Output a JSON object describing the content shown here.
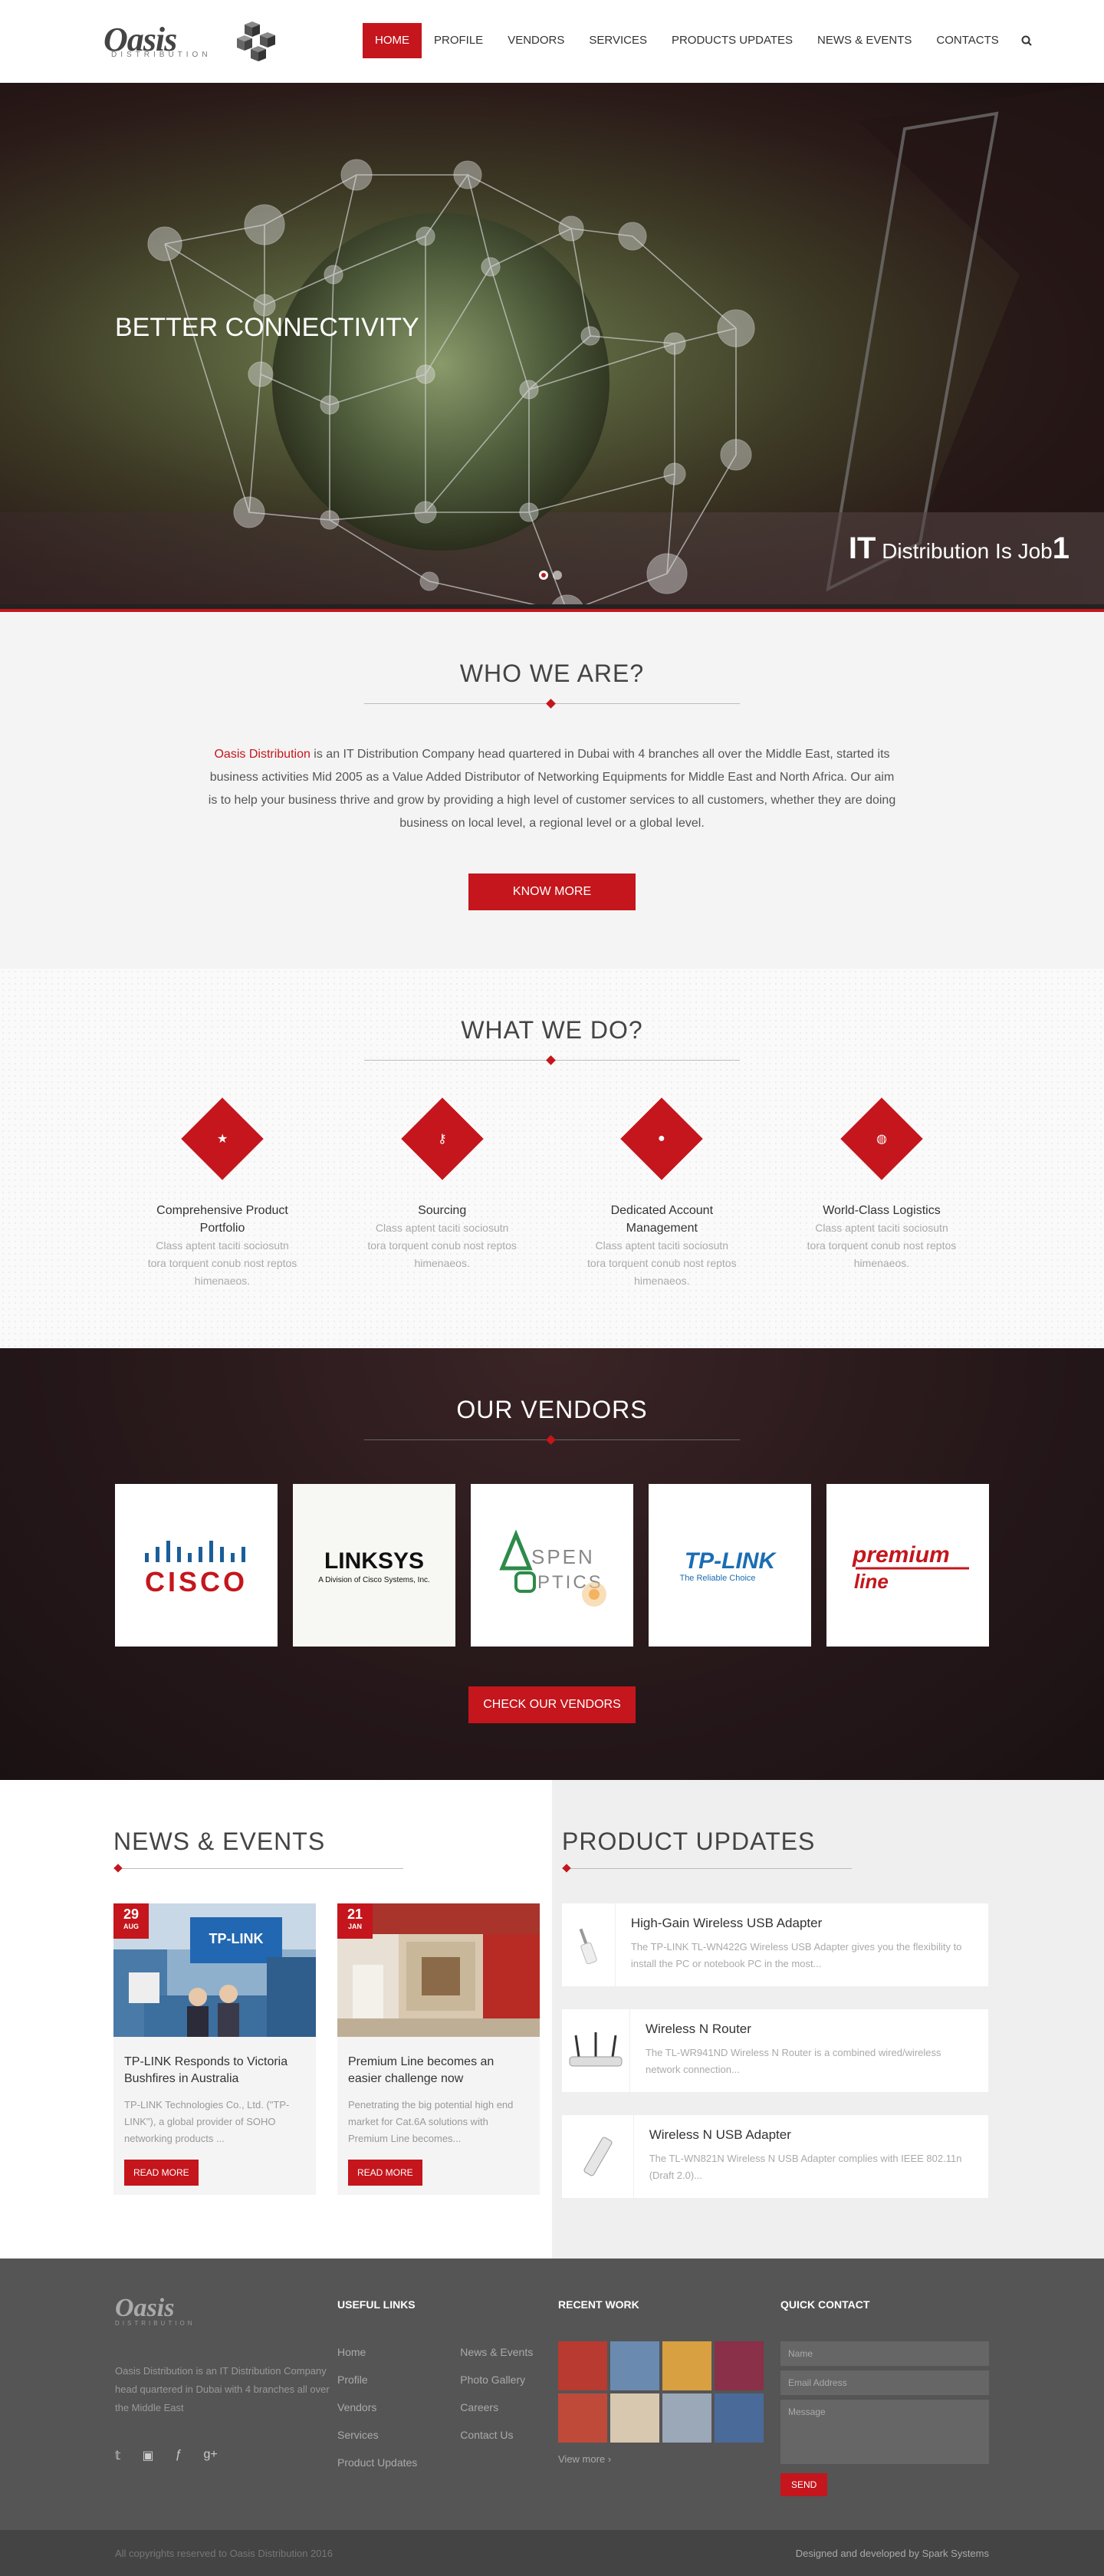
{
  "brand": {
    "logo_word": "Oasis",
    "logo_sub": "DISTRIBUTION"
  },
  "nav": {
    "items": [
      {
        "label": "HOME",
        "active": true
      },
      {
        "label": "PROFILE"
      },
      {
        "label": "VENDORS"
      },
      {
        "label": "SERVICES"
      },
      {
        "label": "PRODUCTS UPDATES"
      },
      {
        "label": "NEWS & EVENTS"
      },
      {
        "label": "CONTACTS"
      }
    ],
    "search_icon": "search-icon"
  },
  "hero": {
    "title": "BETTER CONNECTIVITY",
    "tagline_big": "IT",
    "tagline_mid": "Distribution Is Job",
    "tagline_num": "1"
  },
  "who": {
    "title": "WHO WE ARE?",
    "highlight": "Oasis Distribution",
    "body": " is an IT Distribution Company head quartered in Dubai with 4 branches all over the Middle East, started its business activities Mid 2005 as a Value Added Distributor of Networking Equipments for Middle East and North Africa. Our aim is to help your business thrive and grow by providing a high level of customer services to all customers, whether they are doing business on local level, a regional level or a global level.",
    "button": "KNOW MORE"
  },
  "what": {
    "title": "WHAT WE DO?",
    "services": [
      {
        "icon": "star-icon",
        "title": "Comprehensive Product Portfolio",
        "text": "Class aptent taciti sociosutn tora torquent conub nost reptos himenaeos."
      },
      {
        "icon": "key-icon",
        "title": "Sourcing",
        "text": "Class aptent taciti sociosutn tora torquent conub nost reptos himenaeos."
      },
      {
        "icon": "user-icon",
        "title": "Dedicated Account Management",
        "text": "Class aptent taciti sociosutn tora torquent conub nost reptos himenaeos."
      },
      {
        "icon": "globe-icon",
        "title": "World-Class Logistics",
        "text": "Class aptent taciti sociosutn tora torquent conub nost reptos himenaeos."
      }
    ]
  },
  "vendors": {
    "title": "OUR VENDORS",
    "logos": {
      "cisco": "CISCO",
      "linksys": "LINKSYS",
      "linksys_sub": "A Division of Cisco Systems, Inc.",
      "aspen_1": "SPEN",
      "aspen_2": "PTICS",
      "tplink": "TP-LINK",
      "tplink_sub": "The Reliable Choice",
      "premium_1": "premium",
      "premium_2": "line"
    },
    "button": "CHECK OUR VENDORS"
  },
  "news": {
    "title": "NEWS & EVENTS",
    "items": [
      {
        "day": "29",
        "month": "AUG",
        "title": "TP-LINK Responds to Victoria Bushfires in Australia",
        "excerpt": "TP-LINK Technologies Co., Ltd. (\"TP-LINK\"), a global provider of SOHO networking products ...",
        "button": "READ MORE",
        "sign": "TP-LINK"
      },
      {
        "day": "21",
        "month": "JAN",
        "title": "Premium Line becomes an easier challenge now",
        "excerpt": "Penetrating the big potential high end market for Cat.6A solutions with Premium Line becomes...",
        "button": "READ MORE"
      }
    ]
  },
  "products": {
    "title": "PRODUCT UPDATES",
    "items": [
      {
        "title": "High-Gain Wireless USB Adapter",
        "text": "The TP-LINK TL-WN422G Wireless USB Adapter gives you the flexibility to install the PC or notebook PC in the most..."
      },
      {
        "title": "Wireless N Router",
        "text": "The TL-WR941ND Wireless N Router is a combined wired/wireless network connection..."
      },
      {
        "title": "Wireless N USB Adapter",
        "text": "The TL-WN821N Wireless N USB Adapter complies with IEEE 802.11n (Draft 2.0)..."
      }
    ]
  },
  "footer": {
    "about": "Oasis Distribution is an IT Distribution Company head quartered in Dubai with 4 branches all over the Middle East",
    "useful_title": "USEFUL LINKS",
    "links_col1": [
      "Home",
      "Profile",
      "Vendors",
      "Services",
      "Product Updates"
    ],
    "links_col2": [
      "News & Events",
      "Photo Gallery",
      "Careers",
      "Contact Us"
    ],
    "recent_title": "RECENT WORK",
    "view_more": "View more",
    "contact_title": "QUICK CONTACT",
    "name_ph": "Name",
    "email_ph": "Email Address",
    "message_ph": "Message",
    "send": "SEND",
    "social": [
      "twitter-icon",
      "linkedin-icon",
      "facebook-icon",
      "google-plus-icon"
    ],
    "copyright": "All copyrights reserved to Oasis Distribution 2016",
    "credit": "Designed and developed by Spark Systems"
  }
}
